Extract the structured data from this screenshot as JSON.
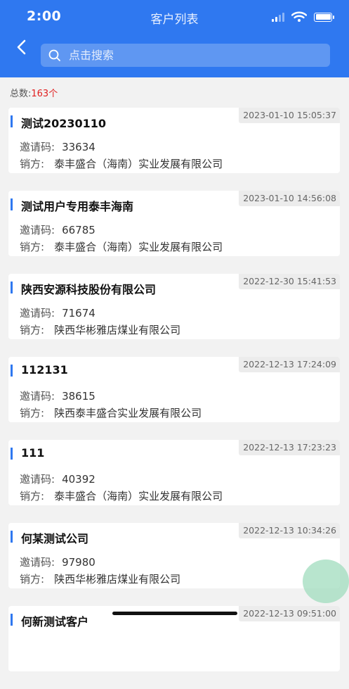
{
  "status": {
    "time": "2:00"
  },
  "header": {
    "title": "客户列表"
  },
  "search": {
    "placeholder": "点击搜索"
  },
  "summary": {
    "label": "总数:",
    "count": "163个"
  },
  "labels": {
    "invite_code": "邀请码:",
    "seller": "销方:"
  },
  "customers": [
    {
      "name": "测试20230110",
      "time": "2023-01-10 15:05:37",
      "code": "33634",
      "seller": "泰丰盛合（海南）实业发展有限公司"
    },
    {
      "name": "测试用户专用泰丰海南",
      "time": "2023-01-10 14:56:08",
      "code": "66785",
      "seller": "泰丰盛合（海南）实业发展有限公司"
    },
    {
      "name": "陕西安源科技股份有限公司",
      "time": "2022-12-30 15:41:53",
      "code": "71674",
      "seller": "陕西华彬雅店煤业有限公司"
    },
    {
      "name": "112131",
      "time": "2022-12-13 17:24:09",
      "code": "38615",
      "seller": "陕西泰丰盛合实业发展有限公司"
    },
    {
      "name": "111",
      "time": "2022-12-13 17:23:23",
      "code": "40392",
      "seller": "泰丰盛合（海南）实业发展有限公司"
    },
    {
      "name": "何某测试公司",
      "time": "2022-12-13 10:34:26",
      "code": "97980",
      "seller": "陕西华彬雅店煤业有限公司"
    },
    {
      "name": "何新测试客户",
      "time": "2022-12-13 09:51:00",
      "code": "",
      "seller": ""
    }
  ],
  "colors": {
    "primary": "#2f78f0",
    "count": "#e02020"
  }
}
